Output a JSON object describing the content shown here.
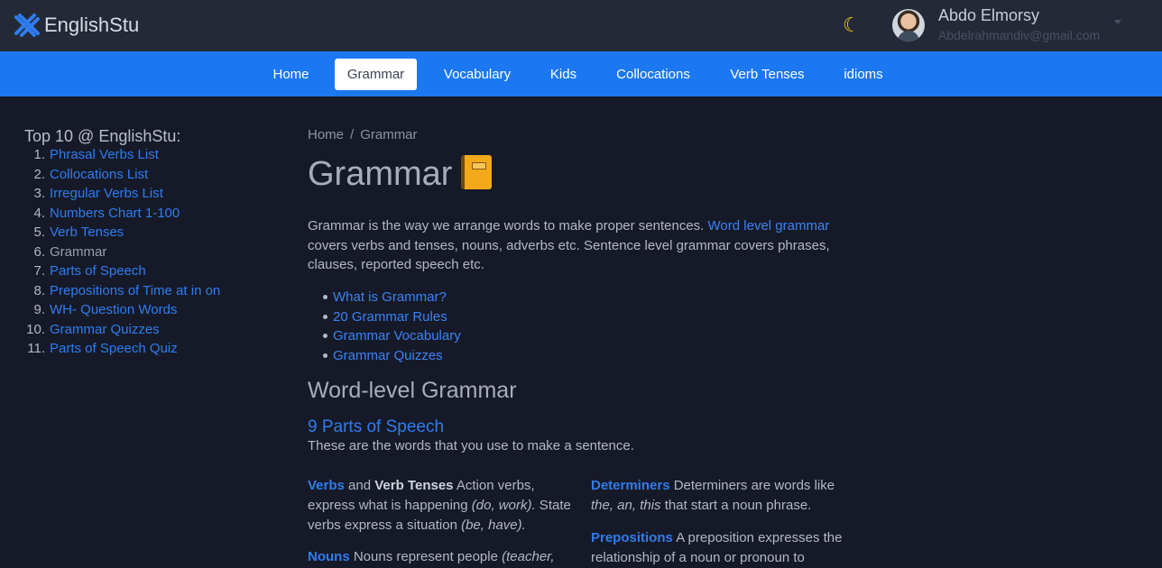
{
  "header": {
    "brand": "EnglishStu",
    "user_name": "Abdo Elmorsy",
    "user_email": "Abdelrahmandiv@gmail.com"
  },
  "nav": {
    "items": [
      {
        "label": "Home"
      },
      {
        "label": "Grammar"
      },
      {
        "label": "Vocabulary"
      },
      {
        "label": "Kids"
      },
      {
        "label": "Collocations"
      },
      {
        "label": "Verb Tenses"
      },
      {
        "label": "idioms"
      }
    ],
    "active": "Grammar"
  },
  "sidebar": {
    "title": "Top 10 @ EnglishStu:",
    "items": [
      {
        "num": "1.",
        "label": "Phrasal Verbs List"
      },
      {
        "num": "2.",
        "label": "Collocations List"
      },
      {
        "num": "3.",
        "label": "Irregular Verbs List"
      },
      {
        "num": "4.",
        "label": "Numbers Chart 1-100"
      },
      {
        "num": "5.",
        "label": "Verb Tenses"
      },
      {
        "num": "6.",
        "label": "Grammar"
      },
      {
        "num": "7.",
        "label": "Parts of Speech"
      },
      {
        "num": "8.",
        "label": "Prepositions of Time at in on"
      },
      {
        "num": "9.",
        "label": "WH- Question Words"
      },
      {
        "num": "10.",
        "label": "Grammar Quizzes"
      },
      {
        "num": "11.",
        "label": "Parts of Speech Quiz"
      }
    ]
  },
  "breadcrumb": {
    "home": "Home",
    "separator": "/",
    "current": "Grammar"
  },
  "main": {
    "title": "Grammar",
    "intro_1": "Grammar is the way we arrange words to make proper sentences. ",
    "intro_link": "Word level grammar",
    "intro_2": " covers verbs and tenses, nouns, adverbs etc. Sentence level grammar covers phrases, clauses, reported speech etc.",
    "links": [
      {
        "label": "What is Grammar?"
      },
      {
        "label": "20 Grammar Rules"
      },
      {
        "label": "Grammar Vocabulary"
      },
      {
        "label": "Grammar Quizzes"
      }
    ],
    "section_title": "Word-level Grammar",
    "subsection_link": "9 Parts of Speech",
    "subsection_desc": "These are the words that you use to make a sentence.",
    "verbs": {
      "kw": "Verbs",
      "and": " and ",
      "bold": "Verb Tenses",
      "text1": " Action verbs, express what is happening ",
      "ex1": "(do, work).",
      "text2": " State verbs express a situation ",
      "ex2": "(be, have)."
    },
    "nouns": {
      "kw": "Nouns",
      "text": " Nouns represent people ",
      "ex": "(teacher,"
    },
    "determiners": {
      "kw": "Determiners",
      "text1": " Determiners are words like ",
      "ex": "the, an, this",
      "text2": " that start a noun phrase."
    },
    "prepositions": {
      "kw": "Prepositions",
      "text": " A preposition expresses the relationship of a noun or pronoun to"
    }
  }
}
